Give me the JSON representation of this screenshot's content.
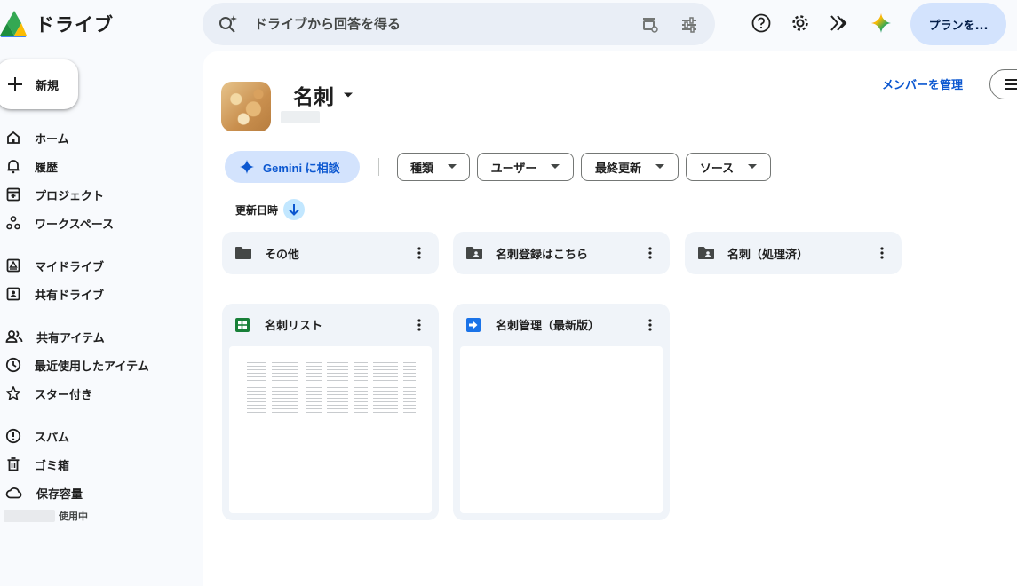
{
  "app": {
    "title": "ドライブ"
  },
  "search": {
    "placeholder": "ドライブから回答を得る"
  },
  "header": {
    "plan_label": "プランを..."
  },
  "sidebar": {
    "new_label": "新規",
    "items": [
      {
        "label": "ホーム",
        "icon": "home-icon"
      },
      {
        "label": "履歴",
        "icon": "bell-icon"
      },
      {
        "label": "プロジェクト",
        "icon": "project-icon"
      },
      {
        "label": "ワークスペース",
        "icon": "workspace-icon"
      },
      {
        "label": "マイドライブ",
        "icon": "my-drive-icon"
      },
      {
        "label": "共有ドライブ",
        "icon": "shared-drive-icon"
      },
      {
        "label": "共有アイテム",
        "icon": "people-icon"
      },
      {
        "label": "最近使用したアイテム",
        "icon": "clock-icon"
      },
      {
        "label": "スター付き",
        "icon": "star-icon"
      },
      {
        "label": "スパム",
        "icon": "spam-icon"
      },
      {
        "label": "ゴミ箱",
        "icon": "trash-icon"
      },
      {
        "label": "保存容量",
        "icon": "cloud-icon"
      }
    ],
    "storage_suffix": "使用中"
  },
  "main": {
    "title": "名刺",
    "manage_members": "メンバーを管理",
    "gemini_chip": "Gemini に相談",
    "filters": [
      "種類",
      "ユーザー",
      "最終更新",
      "ソース"
    ],
    "sort_label": "更新日時",
    "folders": [
      {
        "name": "その他",
        "icon": "folder-icon"
      },
      {
        "name": "名刺登録はこちら",
        "icon": "shared-folder-icon"
      },
      {
        "name": "名刺（処理済）",
        "icon": "shared-folder-icon"
      }
    ],
    "files": [
      {
        "name": "名刺リスト",
        "icon": "sheets-icon"
      },
      {
        "name": "名刺管理（最新版）",
        "icon": "shortcut-icon"
      }
    ]
  },
  "colors": {
    "accent": "#0b57d0",
    "chip_bg": "#d3e3fd",
    "card_bg": "#f0f4f9",
    "sheets": "#188038",
    "shortcut": "#1a73e8"
  }
}
